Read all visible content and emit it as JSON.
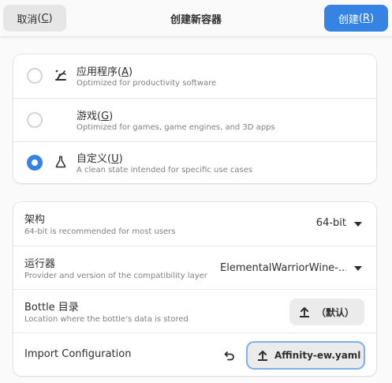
{
  "header": {
    "cancel_label": "取消",
    "cancel_mnemonic": "C",
    "title": "创建新容器",
    "create_label": "创建",
    "create_mnemonic": "R"
  },
  "environments": [
    {
      "icon": "robot-arm-icon",
      "title_label": "应用程序",
      "mnemonic": "A",
      "subtitle": "Optimized for productivity software",
      "selected": false
    },
    {
      "icon": "gamepad-icon",
      "title_label": "游戏",
      "mnemonic": "G",
      "subtitle": "Optimized for games, game engines, and 3D apps",
      "selected": false
    },
    {
      "icon": "flask-icon",
      "title_label": "自定义",
      "mnemonic": "U",
      "subtitle": "A clean state intended for specific use cases",
      "selected": true
    }
  ],
  "settings": {
    "architecture": {
      "label": "架构",
      "subtitle": "64-bit is recommended for most users",
      "value": "64-bit"
    },
    "runner": {
      "label": "运行器",
      "subtitle": "Provider and version of the compatibility layer",
      "value": "ElementalWarriorWine-..."
    },
    "bottle_dir": {
      "label": "Bottle 目录",
      "subtitle": "Location where the bottle's data is stored",
      "button_label": "（默认）"
    },
    "import_config": {
      "label": "Import Configuration",
      "button_label": "Affinity-ew.yaml"
    }
  },
  "colors": {
    "accent": "#3584e4",
    "background": "#fafafa",
    "card": "#ffffff"
  }
}
